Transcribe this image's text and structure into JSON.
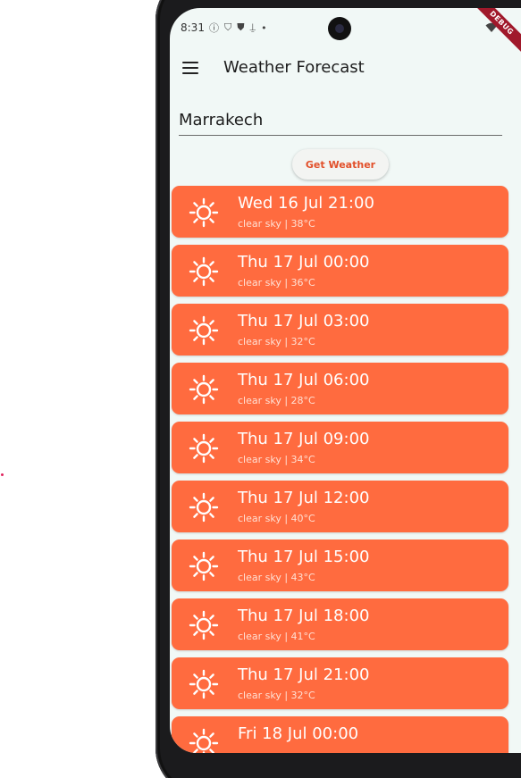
{
  "status": {
    "time": "8:31",
    "debug_label": "DEBUG"
  },
  "app": {
    "title": "Weather Forecast"
  },
  "search": {
    "city_value": "Marrakech"
  },
  "actions": {
    "get_weather_label": "Get Weather"
  },
  "colors": {
    "card": "#ff6b3f",
    "button_text": "#e2502b",
    "background": "#f1f8f6"
  },
  "forecast": [
    {
      "datetime": "Wed 16 Jul 21:00",
      "summary": "clear sky | 38°C",
      "icon": "sun-icon"
    },
    {
      "datetime": "Thu 17 Jul 00:00",
      "summary": "clear sky | 36°C",
      "icon": "sun-icon"
    },
    {
      "datetime": "Thu 17 Jul 03:00",
      "summary": "clear sky | 32°C",
      "icon": "sun-icon"
    },
    {
      "datetime": "Thu 17 Jul 06:00",
      "summary": "clear sky | 28°C",
      "icon": "sun-icon"
    },
    {
      "datetime": "Thu 17 Jul 09:00",
      "summary": "clear sky | 34°C",
      "icon": "sun-icon"
    },
    {
      "datetime": "Thu 17 Jul 12:00",
      "summary": "clear sky | 40°C",
      "icon": "sun-icon"
    },
    {
      "datetime": "Thu 17 Jul 15:00",
      "summary": "clear sky | 43°C",
      "icon": "sun-icon"
    },
    {
      "datetime": "Thu 17 Jul 18:00",
      "summary": "clear sky | 41°C",
      "icon": "sun-icon"
    },
    {
      "datetime": "Thu 17 Jul 21:00",
      "summary": "clear sky | 32°C",
      "icon": "sun-icon"
    },
    {
      "datetime": "Fri 18 Jul 00:00",
      "summary": "",
      "icon": "sun-icon"
    }
  ]
}
